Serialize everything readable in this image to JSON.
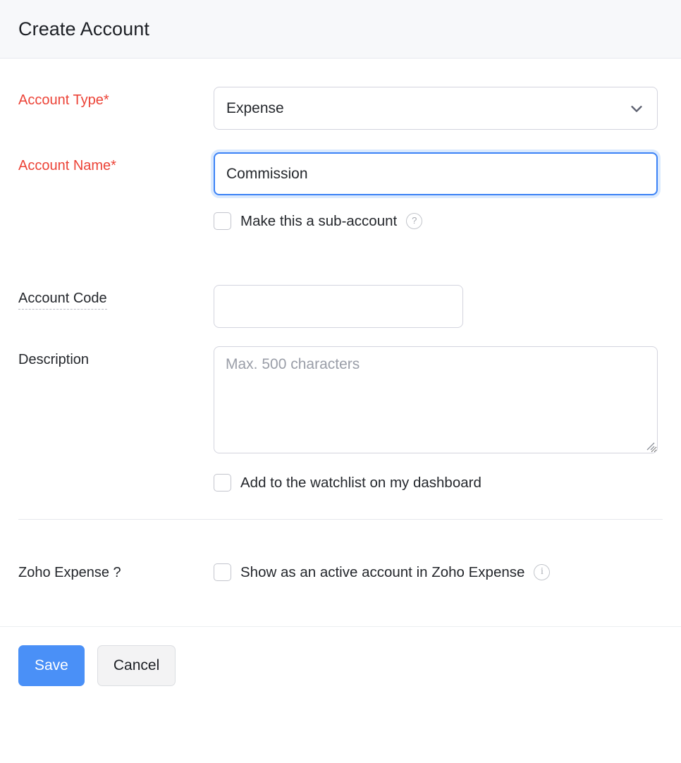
{
  "header": {
    "title": "Create Account"
  },
  "form": {
    "account_type": {
      "label": "Account Type*",
      "value": "Expense",
      "icon": "chevron-down-icon"
    },
    "account_name": {
      "label": "Account Name*",
      "value": "Commission",
      "placeholder": ""
    },
    "sub_account": {
      "checkbox_label": "Make this a sub-account",
      "checked": false,
      "help_icon": "question-mark-icon",
      "help_glyph": "?"
    },
    "account_code": {
      "label": "Account Code",
      "value": "",
      "placeholder": ""
    },
    "description": {
      "label": "Description",
      "value": "",
      "placeholder": "Max. 500 characters"
    },
    "watchlist": {
      "checkbox_label": "Add to the watchlist on my dashboard",
      "checked": false
    },
    "zoho_expense": {
      "label": "Zoho Expense ?",
      "checkbox_label": "Show as an active account in Zoho Expense",
      "checked": false,
      "info_icon": "info-icon",
      "info_glyph": "i"
    }
  },
  "footer": {
    "save_label": "Save",
    "cancel_label": "Cancel"
  },
  "colors": {
    "required_label": "#ec4337",
    "primary_button": "#4a90f7",
    "focus_border": "#3b82f6",
    "header_bg": "#f7f8fa"
  }
}
